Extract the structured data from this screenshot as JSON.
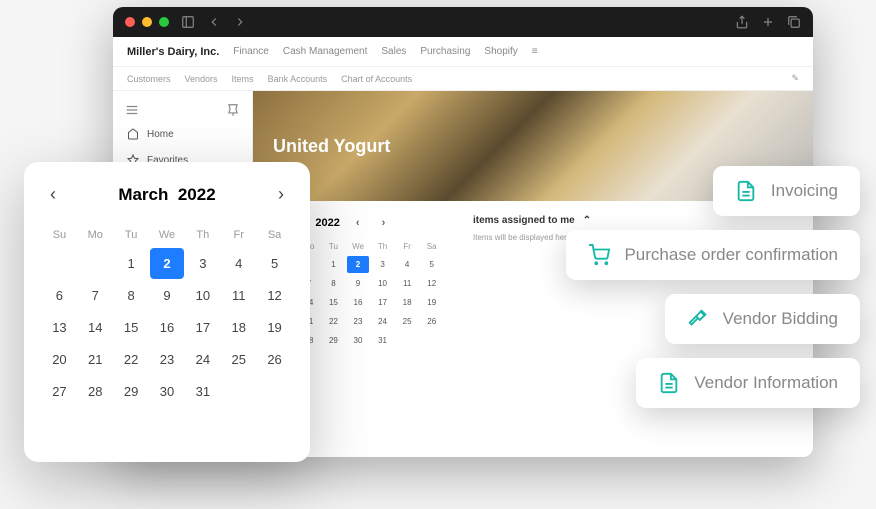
{
  "app": {
    "name": "Miller's Dairy, Inc."
  },
  "nav1": [
    "Finance",
    "Cash Management",
    "Sales",
    "Purchasing",
    "Shopify"
  ],
  "nav2": [
    "Customers",
    "Vendors",
    "Items",
    "Bank Accounts",
    "Chart of Accounts"
  ],
  "sidebar": {
    "home": "Home",
    "favorites": "Favorites"
  },
  "hero": {
    "title": "United Yogurt"
  },
  "calendar": {
    "month": "March",
    "year": "2022",
    "title": "March 2022",
    "dayHeaders": [
      "Su",
      "Mo",
      "Tu",
      "We",
      "Th",
      "Fr",
      "Sa"
    ],
    "selected": 2,
    "weeks": [
      [
        "",
        "",
        "1",
        "2",
        "3",
        "4",
        "5"
      ],
      [
        "6",
        "7",
        "8",
        "9",
        "10",
        "11",
        "12"
      ],
      [
        "13",
        "14",
        "15",
        "16",
        "17",
        "18",
        "19"
      ],
      [
        "20",
        "21",
        "22",
        "23",
        "24",
        "25",
        "26"
      ],
      [
        "27",
        "28",
        "29",
        "30",
        "31",
        "",
        ""
      ]
    ]
  },
  "assigned": {
    "title": "items assigned to me",
    "desc": "Items will be displayed here after they are assigned to you."
  },
  "chips": [
    {
      "icon": "doc",
      "label": "Invoicing"
    },
    {
      "icon": "cart",
      "label": "Purchase order confirmation"
    },
    {
      "icon": "gavel",
      "label": "Vendor Bidding"
    },
    {
      "icon": "doc",
      "label": "Vendor Information"
    }
  ]
}
